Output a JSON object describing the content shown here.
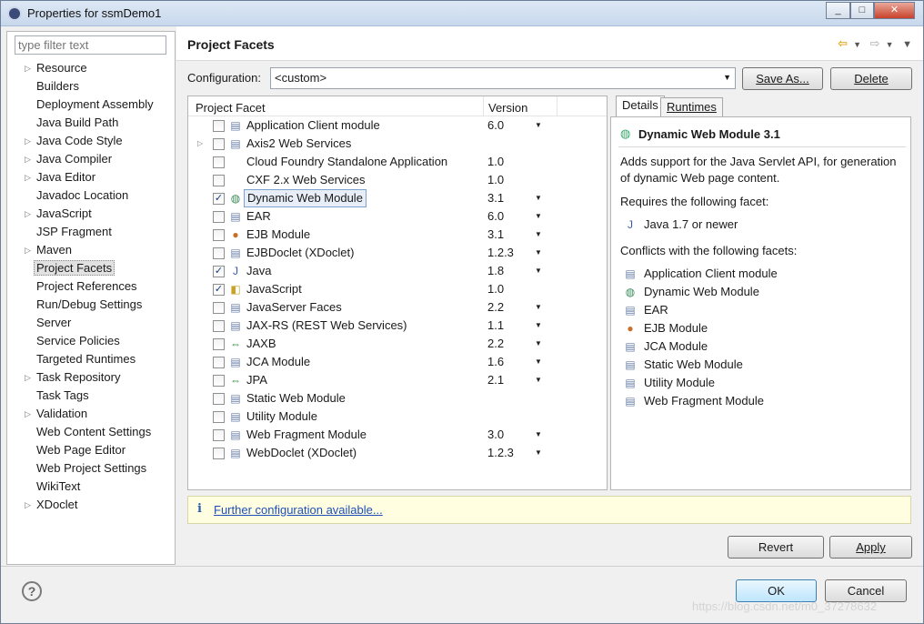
{
  "window": {
    "title": "Properties for ssmDemo1",
    "controls": [
      "_",
      "□",
      "✕"
    ]
  },
  "filter": {
    "placeholder": "type filter text"
  },
  "nav": {
    "items": [
      {
        "label": "Resource",
        "expandable": true
      },
      {
        "label": "Builders",
        "expandable": false
      },
      {
        "label": "Deployment Assembly",
        "expandable": false
      },
      {
        "label": "Java Build Path",
        "expandable": false
      },
      {
        "label": "Java Code Style",
        "expandable": true
      },
      {
        "label": "Java Compiler",
        "expandable": true
      },
      {
        "label": "Java Editor",
        "expandable": true
      },
      {
        "label": "Javadoc Location",
        "expandable": false
      },
      {
        "label": "JavaScript",
        "expandable": true
      },
      {
        "label": "JSP Fragment",
        "expandable": false
      },
      {
        "label": "Maven",
        "expandable": true
      },
      {
        "label": "Project Facets",
        "expandable": false,
        "selected": true
      },
      {
        "label": "Project References",
        "expandable": false
      },
      {
        "label": "Run/Debug Settings",
        "expandable": false
      },
      {
        "label": "Server",
        "expandable": false
      },
      {
        "label": "Service Policies",
        "expandable": false
      },
      {
        "label": "Targeted Runtimes",
        "expandable": false
      },
      {
        "label": "Task Repository",
        "expandable": true
      },
      {
        "label": "Task Tags",
        "expandable": false
      },
      {
        "label": "Validation",
        "expandable": true
      },
      {
        "label": "Web Content Settings",
        "expandable": false
      },
      {
        "label": "Web Page Editor",
        "expandable": false
      },
      {
        "label": "Web Project Settings",
        "expandable": false
      },
      {
        "label": "WikiText",
        "expandable": false
      },
      {
        "label": "XDoclet",
        "expandable": true
      }
    ]
  },
  "page": {
    "title": "Project Facets"
  },
  "config": {
    "label": "Configuration:",
    "value": "<custom>",
    "save_as_label": "Save As...",
    "delete_label": "Delete"
  },
  "facets": {
    "col_facet": "Project Facet",
    "col_version": "Version",
    "rows": [
      {
        "name": "Application Client module",
        "version": "6.0",
        "checked": false,
        "dropdown": true,
        "expandable": false,
        "icon": "page-icon"
      },
      {
        "name": "Axis2 Web Services",
        "version": "",
        "checked": false,
        "dropdown": false,
        "expandable": true,
        "icon": "page-icon"
      },
      {
        "name": "Cloud Foundry Standalone Application",
        "version": "1.0",
        "checked": false,
        "dropdown": false,
        "expandable": false,
        "icon": "none"
      },
      {
        "name": "CXF 2.x Web Services",
        "version": "1.0",
        "checked": false,
        "dropdown": false,
        "expandable": false,
        "icon": "none"
      },
      {
        "name": "Dynamic Web Module",
        "version": "3.1",
        "checked": true,
        "dropdown": true,
        "expandable": false,
        "icon": "globe-icon",
        "selected": true
      },
      {
        "name": "EAR",
        "version": "6.0",
        "checked": false,
        "dropdown": true,
        "expandable": false,
        "icon": "page-icon"
      },
      {
        "name": "EJB Module",
        "version": "3.1",
        "checked": false,
        "dropdown": true,
        "expandable": false,
        "icon": "bean-icon"
      },
      {
        "name": "EJBDoclet (XDoclet)",
        "version": "1.2.3",
        "checked": false,
        "dropdown": true,
        "expandable": false,
        "icon": "page-icon"
      },
      {
        "name": "Java",
        "version": "1.8",
        "checked": true,
        "dropdown": true,
        "expandable": false,
        "icon": "java-icon"
      },
      {
        "name": "JavaScript",
        "version": "1.0",
        "checked": true,
        "dropdown": false,
        "expandable": false,
        "icon": "js-icon"
      },
      {
        "name": "JavaServer Faces",
        "version": "2.2",
        "checked": false,
        "dropdown": true,
        "expandable": false,
        "icon": "page-icon"
      },
      {
        "name": "JAX-RS (REST Web Services)",
        "version": "1.1",
        "checked": false,
        "dropdown": true,
        "expandable": false,
        "icon": "page-icon"
      },
      {
        "name": "JAXB",
        "version": "2.2",
        "checked": false,
        "dropdown": true,
        "expandable": false,
        "icon": "arrows-icon"
      },
      {
        "name": "JCA Module",
        "version": "1.6",
        "checked": false,
        "dropdown": true,
        "expandable": false,
        "icon": "page-icon"
      },
      {
        "name": "JPA",
        "version": "2.1",
        "checked": false,
        "dropdown": true,
        "expandable": false,
        "icon": "arrows-icon"
      },
      {
        "name": "Static Web Module",
        "version": "",
        "checked": false,
        "dropdown": false,
        "expandable": false,
        "icon": "page-icon"
      },
      {
        "name": "Utility Module",
        "version": "",
        "checked": false,
        "dropdown": false,
        "expandable": false,
        "icon": "page-icon"
      },
      {
        "name": "Web Fragment Module",
        "version": "3.0",
        "checked": false,
        "dropdown": true,
        "expandable": false,
        "icon": "page-icon"
      },
      {
        "name": "WebDoclet (XDoclet)",
        "version": "1.2.3",
        "checked": false,
        "dropdown": true,
        "expandable": false,
        "icon": "page-icon"
      }
    ]
  },
  "details": {
    "tab_details": "Details",
    "tab_runtimes": "Runtimes",
    "title": "Dynamic Web Module 3.1",
    "description": "Adds support for the Java Servlet API, for generation of dynamic Web page content.",
    "requires_label": "Requires the following facet:",
    "requires": [
      {
        "label": "Java 1.7 or newer",
        "icon": "java-icon"
      }
    ],
    "conflicts_label": "Conflicts with the following facets:",
    "conflicts": [
      {
        "label": "Application Client module",
        "icon": "page-icon"
      },
      {
        "label": "Dynamic Web Module",
        "icon": "globe-icon"
      },
      {
        "label": "EAR",
        "icon": "page-icon"
      },
      {
        "label": "EJB Module",
        "icon": "bean-icon"
      },
      {
        "label": "JCA Module",
        "icon": "page-icon"
      },
      {
        "label": "Static Web Module",
        "icon": "page-icon"
      },
      {
        "label": "Utility Module",
        "icon": "page-icon"
      },
      {
        "label": "Web Fragment Module",
        "icon": "page-icon"
      }
    ]
  },
  "info": {
    "link": "Further configuration available..."
  },
  "footer": {
    "revert_label": "Revert",
    "apply_label": "Apply",
    "ok_label": "OK",
    "cancel_label": "Cancel",
    "watermark": "https://blog.csdn.net/m0_37278632"
  }
}
